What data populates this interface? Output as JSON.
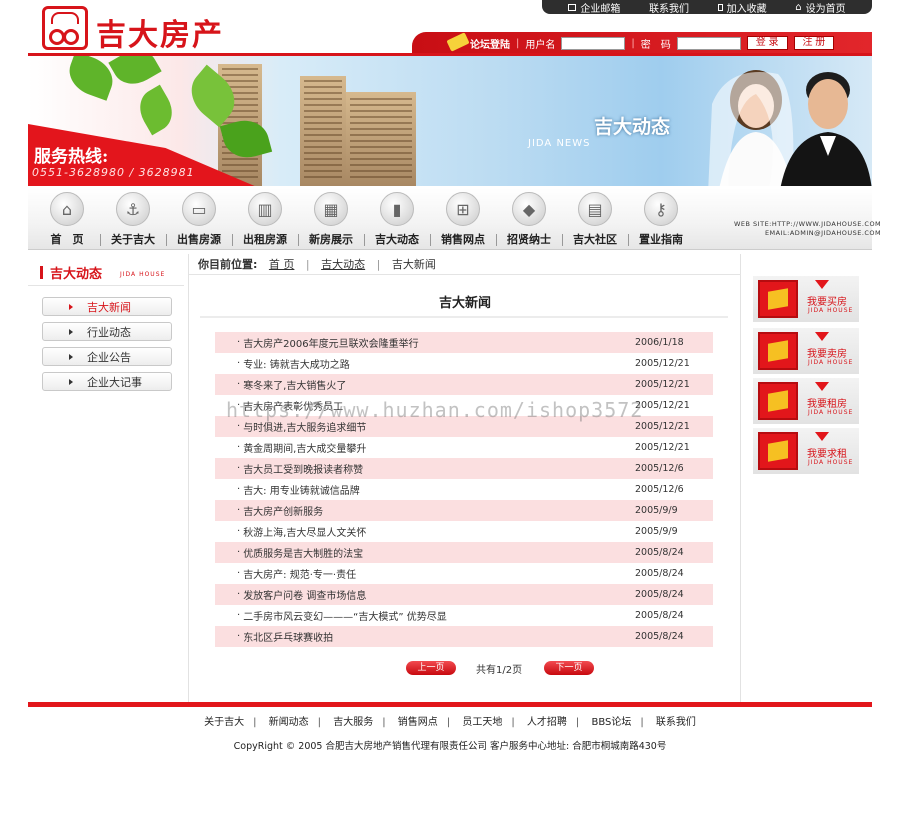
{
  "brand": {
    "name": "吉大房产",
    "logo_char": "吉大"
  },
  "topbar": {
    "items": [
      "企业邮箱",
      "联系我们",
      "加入收藏",
      "设为首页"
    ]
  },
  "login": {
    "forum": "论坛登陆",
    "username_label": "用户名",
    "password_label": "密　码",
    "login_btn": "登 录",
    "register_btn": "注 册",
    "username_value": "",
    "password_value": ""
  },
  "banner": {
    "hotline": "服务热线:",
    "phone": "0551-3628980 / 3628981",
    "title": "吉大动态",
    "subtitle": "JIDA NEWS"
  },
  "nav": {
    "items": [
      "首　页",
      "关于吉大",
      "出售房源",
      "出租房源",
      "新房展示",
      "吉大动态",
      "销售网点",
      "招贤纳士",
      "吉大社区",
      "置业指南"
    ],
    "icons": [
      "house-icon",
      "anchor-icon",
      "monitor-icon",
      "building-icon",
      "buildings-icon",
      "chart-icon",
      "store-icon",
      "stack-icon",
      "books-icon",
      "key-icon"
    ],
    "site": "WEB SITE:HTTP://WWW.JIDAHOUSE.COM",
    "email": "EMAIL:ADMIN@JIDAHOUSE.COM"
  },
  "sidebar": {
    "title": "吉大动态",
    "subtitle": "JIDA HOUSE",
    "items": [
      "吉大新闻",
      "行业动态",
      "企业公告",
      "企业大记事"
    ]
  },
  "breadcrumb": {
    "label": "你目前位置:",
    "home": "首 页",
    "section": "吉大动态",
    "current": "吉大新闻"
  },
  "section_title": "吉大新闻",
  "news": [
    {
      "title": "吉大房产2006年度元旦联欢会隆重举行",
      "date": "2006/1/18"
    },
    {
      "title": "专业: 铸就吉大成功之路",
      "date": "2005/12/21"
    },
    {
      "title": "寒冬来了,吉大销售火了",
      "date": "2005/12/21"
    },
    {
      "title": "吉大房产表彰优秀员工",
      "date": "2005/12/21"
    },
    {
      "title": "与时俱进,吉大服务追求细节",
      "date": "2005/12/21"
    },
    {
      "title": "黄金周期间,吉大成交量攀升",
      "date": "2005/12/21"
    },
    {
      "title": "吉大员工受到晚报读者称赞",
      "date": "2005/12/6"
    },
    {
      "title": "吉大: 用专业铸就诚信品牌",
      "date": "2005/12/6"
    },
    {
      "title": "吉大房产创新服务",
      "date": "2005/9/9"
    },
    {
      "title": "秋游上海,吉大尽显人文关怀",
      "date": "2005/9/9"
    },
    {
      "title": "优质服务是吉大制胜的法宝",
      "date": "2005/8/24"
    },
    {
      "title": "吉大房产: 规范·专一·责任",
      "date": "2005/8/24"
    },
    {
      "title": "发放客户问卷 调查市场信息",
      "date": "2005/8/24"
    },
    {
      "title": "二手房市风云变幻———“吉大模式” 优势尽显",
      "date": "2005/8/24"
    },
    {
      "title": "东北区乒乓球赛收拍",
      "date": "2005/8/24"
    }
  ],
  "watermark": "https://www.huzhan.com/ishop3572",
  "pager": {
    "prev": "上一页",
    "info": "共有1/2页",
    "next": "下一页"
  },
  "ads": [
    {
      "label": "我要买房",
      "en": "JIDA HOUSE"
    },
    {
      "label": "我要卖房",
      "en": "JIDA HOUSE"
    },
    {
      "label": "我要租房",
      "en": "JIDA HOUSE"
    },
    {
      "label": "我要求租",
      "en": "JIDA HOUSE"
    }
  ],
  "footer": {
    "links": [
      "关于吉大",
      "新闻动态",
      "吉大服务",
      "销售网点",
      "员工天地",
      "人才招聘",
      "BBS论坛",
      "联系我们"
    ],
    "copyright": "CopyRight © 2005 合肥吉大房地产销售代理有限责任公司 客户服务中心地址: 合肥市桐城南路430号"
  },
  "colors": {
    "brand_red": "#d7141a",
    "row_pink": "#fbdfe0"
  }
}
